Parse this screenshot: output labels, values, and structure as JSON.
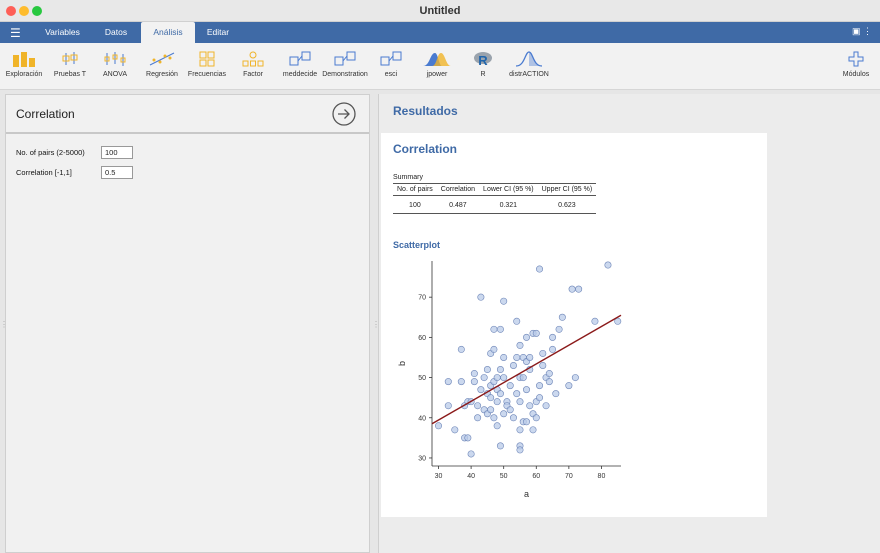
{
  "window": {
    "title": "Untitled"
  },
  "menubar": {
    "tabs": [
      {
        "label": "Variables",
        "active": false
      },
      {
        "label": "Datos",
        "active": false
      },
      {
        "label": "Análisis",
        "active": true
      },
      {
        "label": "Editar",
        "active": false
      }
    ]
  },
  "toolbar": {
    "items": [
      {
        "label": "Exploración",
        "icon": "exploration-icon"
      },
      {
        "label": "Pruebas T",
        "icon": "ttest-icon"
      },
      {
        "label": "ANOVA",
        "icon": "anova-icon"
      },
      {
        "label": "Regresión",
        "icon": "regression-icon"
      },
      {
        "label": "Frecuencias",
        "icon": "frequencies-icon"
      },
      {
        "label": "Factor",
        "icon": "factor-icon"
      },
      {
        "label": "meddecide",
        "icon": "module-icon"
      },
      {
        "label": "Demonstration",
        "icon": "module-icon"
      },
      {
        "label": "esci",
        "icon": "module-icon"
      },
      {
        "label": "jpower",
        "icon": "jpower-icon"
      },
      {
        "label": "R",
        "icon": "r-icon"
      },
      {
        "label": "distrACTION",
        "icon": "distraction-icon"
      }
    ],
    "modules_label": "Módulos"
  },
  "options": {
    "title": "Correlation",
    "pairs_label": "No. of pairs (2-5000)",
    "pairs_value": "100",
    "corr_label": "Correlation [-1,1]",
    "corr_value": "0.5"
  },
  "results": {
    "header": "Resultados",
    "analysis_title": "Correlation",
    "summary_caption": "Summary",
    "table": {
      "columns": [
        "No. of pairs",
        "Correlation",
        "Lower CI (95 %)",
        "Upper CI (95 %)"
      ],
      "rows": [
        [
          "100",
          "0.487",
          "0.321",
          "0.623"
        ]
      ]
    },
    "scatter_title": "Scatterplot"
  },
  "colors": {
    "accent": "#3f6aa6",
    "regression_line": "#8b1a1a",
    "points": "#b9cbe8"
  },
  "chart_data": {
    "type": "scatter",
    "title": "Scatterplot",
    "xlabel": "a",
    "ylabel": "b",
    "xlim": [
      28,
      86
    ],
    "ylim": [
      28,
      79
    ],
    "xticks": [
      30,
      40,
      50,
      60,
      70,
      80
    ],
    "yticks": [
      30,
      40,
      50,
      60,
      70
    ],
    "regression": {
      "x": [
        28,
        86
      ],
      "y": [
        38.5,
        65.5
      ]
    },
    "points": [
      [
        30,
        38
      ],
      [
        33,
        43
      ],
      [
        33,
        49
      ],
      [
        35,
        37
      ],
      [
        37,
        49
      ],
      [
        37,
        57
      ],
      [
        38,
        35
      ],
      [
        38,
        43
      ],
      [
        39,
        35
      ],
      [
        39,
        44
      ],
      [
        40,
        31
      ],
      [
        40,
        44
      ],
      [
        41,
        49
      ],
      [
        41,
        51
      ],
      [
        42,
        40
      ],
      [
        42,
        43
      ],
      [
        43,
        70
      ],
      [
        43,
        47
      ],
      [
        44,
        42
      ],
      [
        44,
        50
      ],
      [
        45,
        41
      ],
      [
        45,
        46
      ],
      [
        45,
        52
      ],
      [
        46,
        42
      ],
      [
        46,
        45
      ],
      [
        46,
        48
      ],
      [
        46,
        56
      ],
      [
        47,
        40
      ],
      [
        47,
        49
      ],
      [
        47,
        57
      ],
      [
        47,
        62
      ],
      [
        48,
        38
      ],
      [
        48,
        44
      ],
      [
        48,
        47
      ],
      [
        48,
        50
      ],
      [
        49,
        33
      ],
      [
        49,
        52
      ],
      [
        49,
        62
      ],
      [
        49,
        46
      ],
      [
        50,
        41
      ],
      [
        50,
        50
      ],
      [
        50,
        55
      ],
      [
        50,
        69
      ],
      [
        51,
        44
      ],
      [
        51,
        43
      ],
      [
        52,
        42
      ],
      [
        52,
        48
      ],
      [
        53,
        53
      ],
      [
        53,
        40
      ],
      [
        54,
        46
      ],
      [
        54,
        55
      ],
      [
        54,
        64
      ],
      [
        55,
        33
      ],
      [
        55,
        32
      ],
      [
        55,
        37
      ],
      [
        55,
        44
      ],
      [
        55,
        50
      ],
      [
        55,
        58
      ],
      [
        56,
        39
      ],
      [
        56,
        50
      ],
      [
        56,
        55
      ],
      [
        57,
        39
      ],
      [
        57,
        47
      ],
      [
        57,
        54
      ],
      [
        57,
        60
      ],
      [
        58,
        43
      ],
      [
        58,
        52
      ],
      [
        58,
        55
      ],
      [
        59,
        37
      ],
      [
        59,
        41
      ],
      [
        59,
        61
      ],
      [
        60,
        40
      ],
      [
        60,
        44
      ],
      [
        60,
        61
      ],
      [
        61,
        48
      ],
      [
        61,
        45
      ],
      [
        61,
        77
      ],
      [
        62,
        53
      ],
      [
        62,
        56
      ],
      [
        63,
        43
      ],
      [
        63,
        50
      ],
      [
        64,
        49
      ],
      [
        64,
        51
      ],
      [
        65,
        60
      ],
      [
        65,
        57
      ],
      [
        66,
        46
      ],
      [
        67,
        62
      ],
      [
        68,
        65
      ],
      [
        70,
        48
      ],
      [
        71,
        72
      ],
      [
        72,
        50
      ],
      [
        73,
        72
      ],
      [
        78,
        64
      ],
      [
        82,
        78
      ],
      [
        85,
        64
      ]
    ]
  }
}
